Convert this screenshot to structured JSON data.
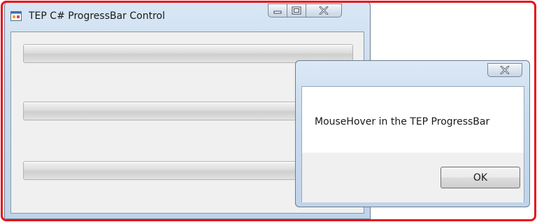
{
  "main_window": {
    "title": "TEP C# ProgressBar Control",
    "icon": "winforms-app-icon",
    "caption_buttons": {
      "minimize_icon": "minimize-icon",
      "maximize_icon": "maximize-icon",
      "close_icon": "close-icon"
    },
    "progress_bars": [
      {
        "value": 0
      },
      {
        "value": 0
      },
      {
        "value": 0
      }
    ]
  },
  "message_box": {
    "text": "MouseHover in the TEP ProgressBar",
    "ok_label": "OK",
    "close_icon": "close-icon"
  },
  "colors": {
    "highlight_border": "#e5141b",
    "window_chrome": "#c8dbef",
    "client_background": "#f0f0f0"
  }
}
